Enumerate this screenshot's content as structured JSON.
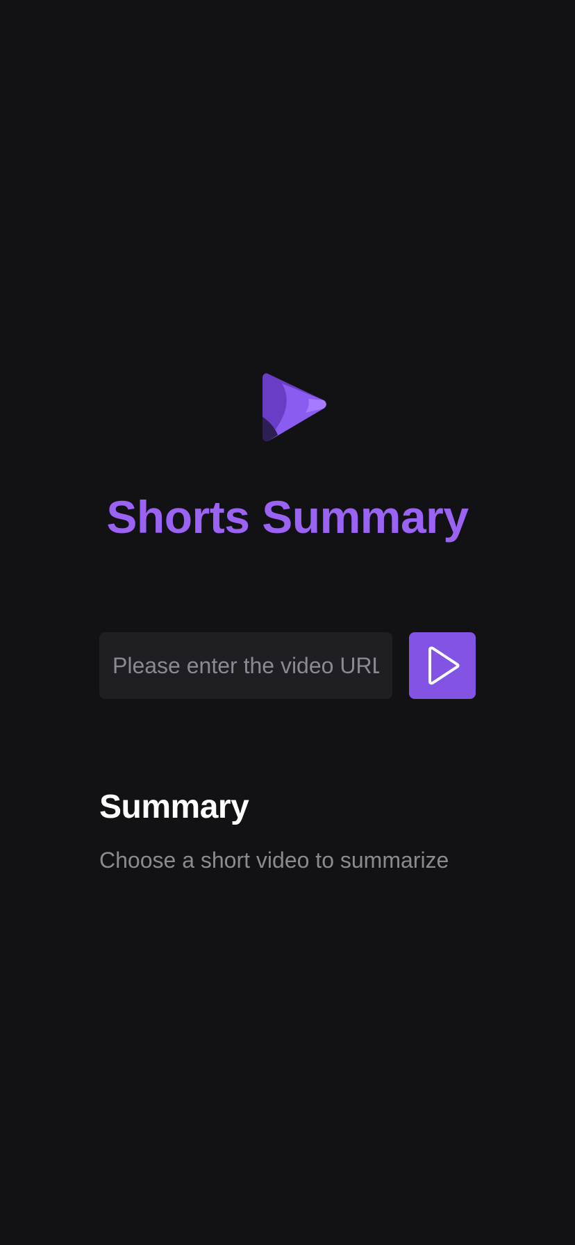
{
  "app": {
    "title": "Shorts Summary",
    "logo_icon": "video-play-logo-icon",
    "accent_color": "#9a63f4"
  },
  "url_input": {
    "value": "",
    "placeholder": "Please enter the video URL"
  },
  "submit_button": {
    "icon": "play-icon",
    "color": "#8354e3"
  },
  "summary": {
    "heading": "Summary",
    "text": "Choose a short video to summarize"
  }
}
